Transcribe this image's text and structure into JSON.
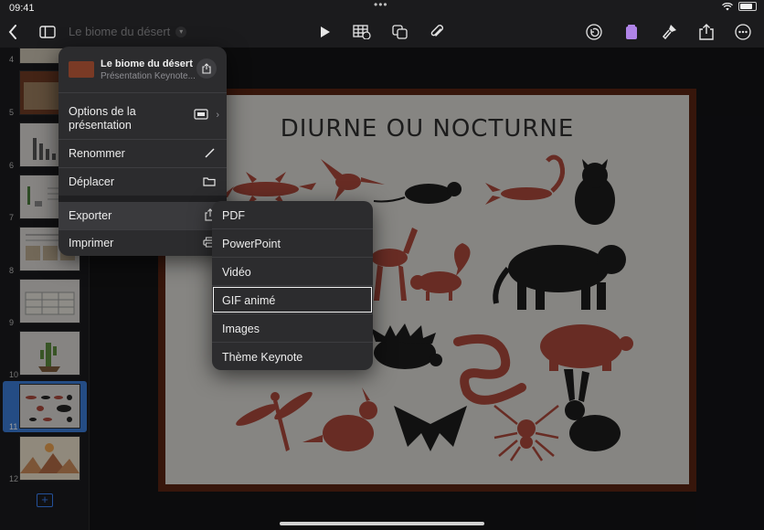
{
  "status": {
    "time": "09:41",
    "dots": "•••"
  },
  "toolbar": {
    "title": "Le biome du désert",
    "icons": [
      "back-icon",
      "sidebar-icon",
      "play-icon",
      "table-icon",
      "shapes-icon",
      "attachment-icon",
      "undo-icon",
      "format-icon",
      "brush-icon",
      "share-icon",
      "more-icon"
    ]
  },
  "navigator": {
    "slides": [
      {
        "num": "4"
      },
      {
        "num": "5"
      },
      {
        "num": "6"
      },
      {
        "num": "7"
      },
      {
        "num": "8"
      },
      {
        "num": "9"
      },
      {
        "num": "10"
      },
      {
        "num": "11"
      },
      {
        "num": "12"
      }
    ],
    "selected": "11"
  },
  "slide": {
    "title": "DIURNE OU NOCTURNE"
  },
  "popover": {
    "doc_name": "Le biome du désert",
    "doc_sub": "Présentation Keynote...",
    "items": [
      {
        "label": "Options de la présentation"
      },
      {
        "label": "Renommer"
      },
      {
        "label": "Déplacer"
      },
      {
        "label": "Exporter"
      },
      {
        "label": "Imprimer"
      }
    ]
  },
  "export_menu": {
    "items": [
      {
        "label": "PDF"
      },
      {
        "label": "PowerPoint"
      },
      {
        "label": "Vidéo"
      },
      {
        "label": "GIF animé"
      },
      {
        "label": "Images"
      },
      {
        "label": "Thème Keynote"
      }
    ],
    "highlighted": "GIF animé"
  },
  "colors": {
    "accent": "#3a82f7",
    "silhouette_red": "#a8473a",
    "silhouette_dark": "#1c1c1c",
    "frame": "#5a2412"
  }
}
